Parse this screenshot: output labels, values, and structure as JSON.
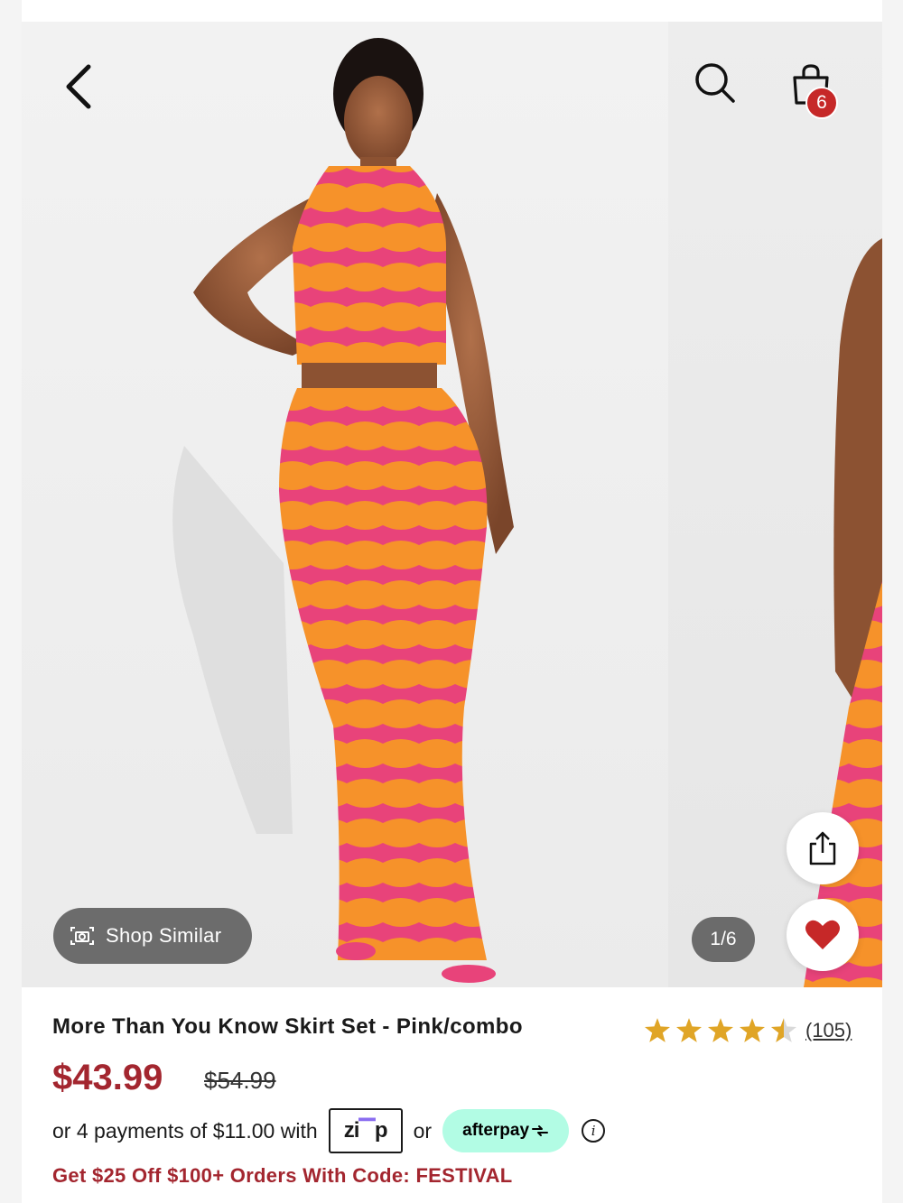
{
  "header": {
    "back_icon": "chevron-left-icon",
    "search_icon": "search-icon",
    "bag_icon": "shopping-bag-icon",
    "bag_count": "6"
  },
  "gallery": {
    "shop_similar_label": "Shop Similar",
    "shop_similar_icon": "camera-icon",
    "counter": "1/6",
    "share_icon": "share-icon",
    "favorite_icon": "heart-icon"
  },
  "product": {
    "title": "More Than You Know Skirt Set  - Pink/combo",
    "rating": 4.5,
    "review_count": "(105)",
    "price": "$43.99",
    "original_price": "$54.99",
    "payments_text": "or 4 payments of $11.00 with",
    "zip_label_left": "zi",
    "zip_label_right": "p",
    "or_text": "or",
    "afterpay_label": "afterpay",
    "promo_text": "Get $25 Off $100+ Orders With Code: FESTIVAL"
  },
  "colors": {
    "price_red": "#a3262f",
    "badge_red": "#c62828",
    "star_gold": "#e0a526",
    "afterpay_mint": "#b2fce4",
    "zip_purple": "#8a6df0",
    "dress_pink": "#e8437a",
    "dress_orange": "#f6922a"
  }
}
